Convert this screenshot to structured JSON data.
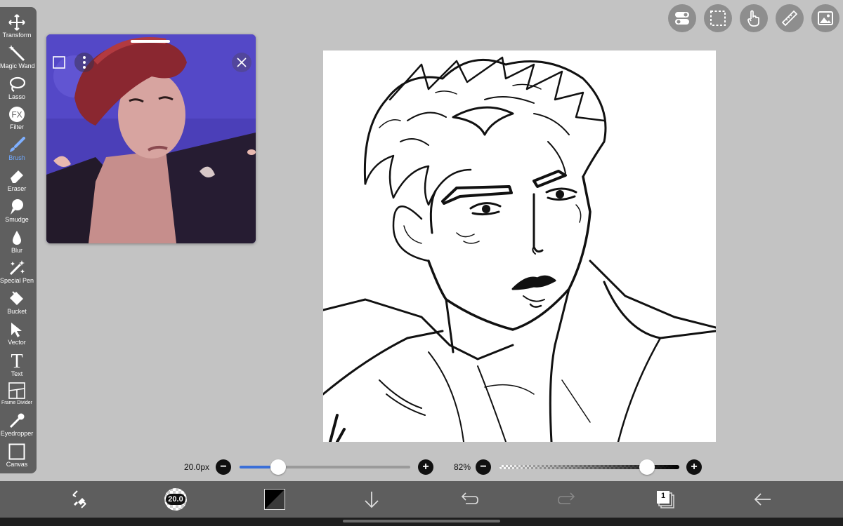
{
  "toolbar": {
    "tools": [
      {
        "label": "Transform",
        "icon": "transform-icon"
      },
      {
        "label": "Magic Wand",
        "icon": "magic-wand-icon"
      },
      {
        "label": "Lasso",
        "icon": "lasso-icon"
      },
      {
        "label": "Filter",
        "icon": "fx-icon",
        "glyph": "FX"
      },
      {
        "label": "Brush",
        "icon": "brush-icon",
        "active": true
      },
      {
        "label": "Eraser",
        "icon": "eraser-icon"
      },
      {
        "label": "Smudge",
        "icon": "smudge-icon"
      },
      {
        "label": "Blur",
        "icon": "blur-icon"
      },
      {
        "label": "Special Pen",
        "icon": "special-pen-icon"
      },
      {
        "label": "Bucket",
        "icon": "bucket-icon"
      },
      {
        "label": "Vector",
        "icon": "vector-icon"
      },
      {
        "label": "Text",
        "icon": "text-icon",
        "glyph": "T"
      },
      {
        "label": "Frame Divider",
        "icon": "frame-divider-icon"
      },
      {
        "label": "Eyedropper",
        "icon": "eyedropper-icon"
      },
      {
        "label": "Canvas",
        "icon": "canvas-icon"
      }
    ]
  },
  "top_right": [
    "toggle-icon",
    "selection-icon",
    "hand-icon",
    "ruler-icon",
    "image-icon"
  ],
  "reference_window": {
    "icons": [
      "square-icon",
      "more-icon",
      "close-icon"
    ]
  },
  "brush_size": {
    "label": "20.0px",
    "fill_fraction": 0.18
  },
  "opacity": {
    "label": "82%",
    "fill_fraction": 0.82
  },
  "bottom_bar": {
    "brush_badge": "20.0",
    "icons": [
      "tool-switch-icon",
      "brush-preview-icon",
      "color-swatch-icon",
      "download-icon",
      "undo-icon",
      "redo-icon",
      "layers-icon",
      "back-icon"
    ],
    "layer_count": "1"
  },
  "colors": {
    "toolbar": "#5f5f5f",
    "background": "#c3c3c3",
    "accent": "#3a6fd8",
    "active_label": "#6fa8ff"
  }
}
